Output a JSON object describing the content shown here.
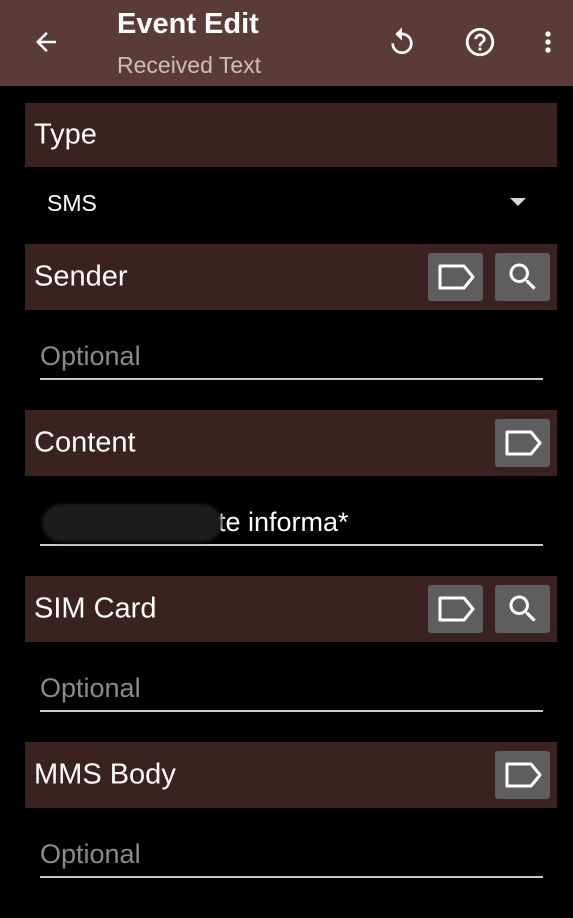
{
  "appbar": {
    "title": "Event Edit",
    "subtitle": "Received Text",
    "icons": [
      "arrow-back-icon",
      "reset-icon",
      "help-icon",
      "more-vert-icon"
    ]
  },
  "type_section": {
    "label": "Type",
    "selected": "SMS"
  },
  "sender_section": {
    "label": "Sender",
    "placeholder": "Optional"
  },
  "content_section": {
    "label": "Content",
    "value": "te informa*"
  },
  "sim_section": {
    "label": "SIM Card",
    "placeholder": "Optional"
  },
  "mms_section": {
    "label": "MMS Body",
    "placeholder": "Optional"
  },
  "colors": {
    "appbar": "#5b3b36",
    "section_header": "#3a2220",
    "button": "#5e5e5e",
    "background": "#000000"
  }
}
